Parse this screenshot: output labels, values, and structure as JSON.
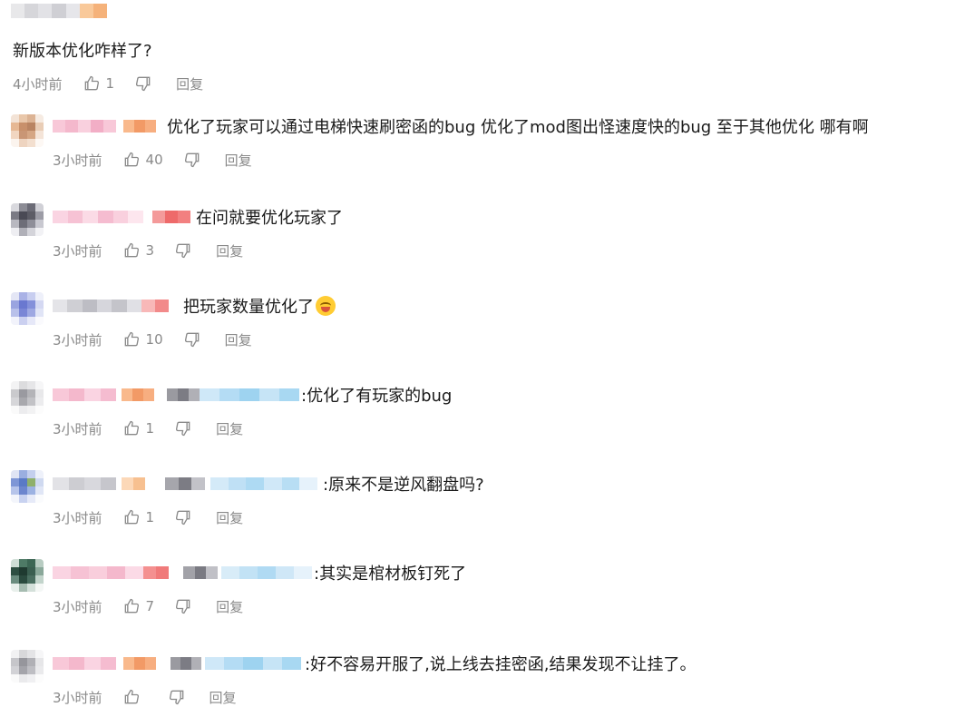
{
  "top_comment": {
    "text": "新版本优化咋样了?",
    "time": "4小时前",
    "likes": "1",
    "reply_label": "回复"
  },
  "replies": [
    {
      "text": "优化了玩家可以通过电梯快速刷密函的bug 优化了mod图出怪速度快的bug 至于其他优化 哪有啊",
      "time": "3小时前",
      "likes": "40",
      "reply_label": "回复"
    },
    {
      "text": "在问就要优化玩家了",
      "time": "3小时前",
      "likes": "3",
      "reply_label": "回复"
    },
    {
      "text": "把玩家数量优化了",
      "time": "3小时前",
      "likes": "10",
      "reply_label": "回复",
      "emoji": "laughing-crying-emoji"
    },
    {
      "text": ":优化了有玩家的bug",
      "time": "3小时前",
      "likes": "1",
      "reply_label": "回复"
    },
    {
      "text": ":原来不是逆风翻盘吗?",
      "time": "3小时前",
      "likes": "1",
      "reply_label": "回复"
    },
    {
      "text": ":其实是棺材板钉死了",
      "time": "3小时前",
      "likes": "7",
      "reply_label": "回复"
    },
    {
      "text": ":好不容易开服了,说上线去挂密函,结果发现不让挂了。",
      "time": "3小时前",
      "likes": "",
      "reply_label": "回复"
    }
  ],
  "colors": {
    "text": "#1a1a1a",
    "meta": "#8a8a8a",
    "name_pink": "#f4b8cc",
    "name_orange": "#f7a877",
    "name_blue": "#9ed3f0",
    "name_gray": "#b8b8b8"
  }
}
